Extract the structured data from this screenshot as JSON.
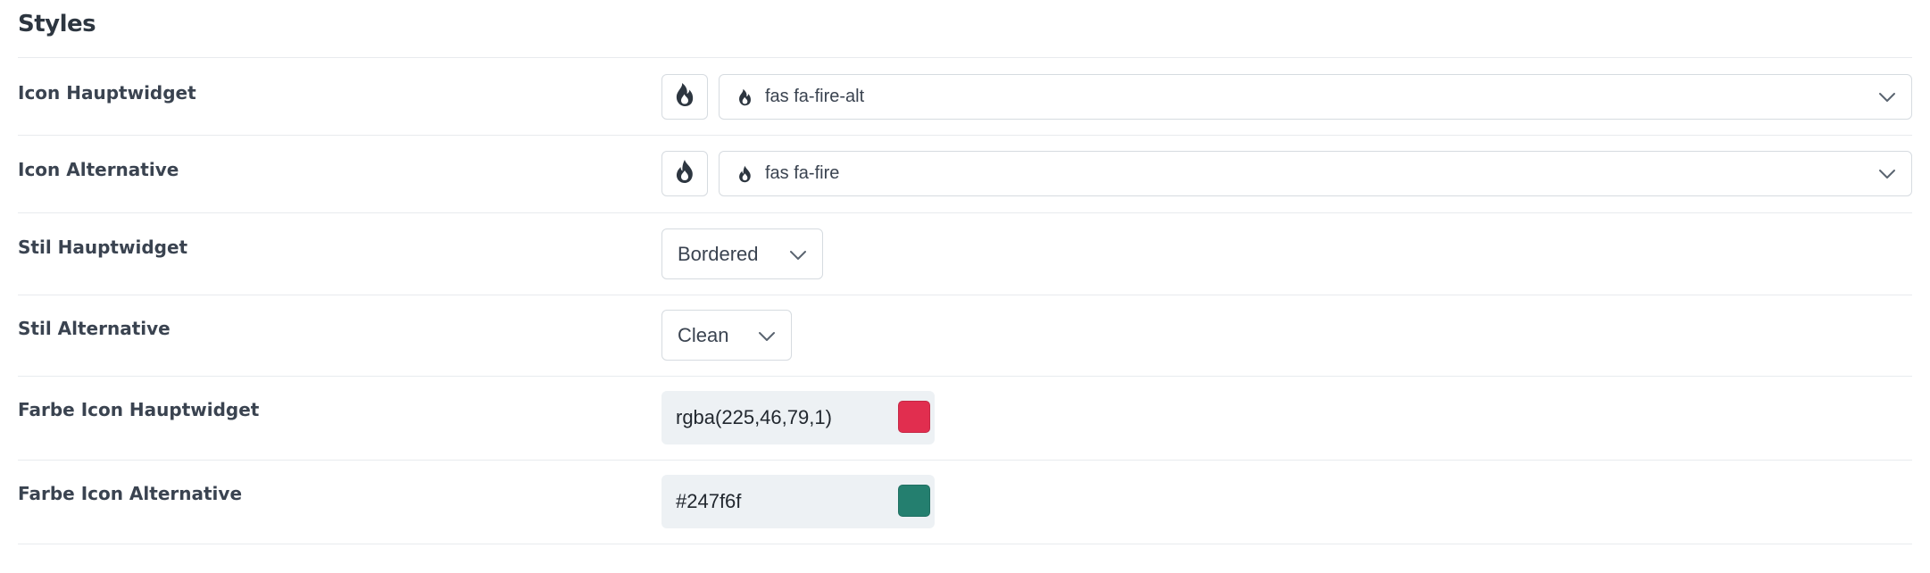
{
  "section": {
    "title": "Styles"
  },
  "rows": [
    {
      "label": "Icon Hauptwidget",
      "icon": "fire-alt-icon",
      "value": "fas fa-fire-alt"
    },
    {
      "label": "Icon Alternative",
      "icon": "fire-icon",
      "value": "fas fa-fire"
    },
    {
      "label": "Stil Hauptwidget",
      "value": "Bordered"
    },
    {
      "label": "Stil Alternative",
      "value": "Clean"
    },
    {
      "label": "Farbe Icon Hauptwidget",
      "value": "rgba(225,46,79,1)",
      "swatch": "#e12e4f"
    },
    {
      "label": "Farbe Icon Alternative",
      "value": "#247f6f",
      "swatch": "#247f6f"
    }
  ],
  "colors": {
    "icon": "#2d3640",
    "border": "#d6dbe0",
    "field_bg": "#edf1f4"
  }
}
